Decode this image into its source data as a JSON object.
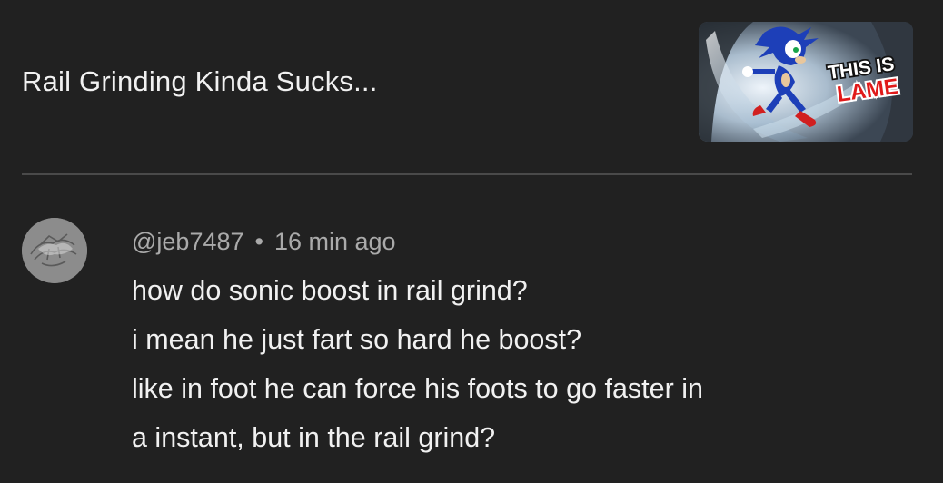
{
  "video": {
    "title": "Rail Grinding Kinda Sucks...",
    "thumbnail": {
      "caption_line1": "THIS IS",
      "caption_line2": "LAME"
    }
  },
  "comment": {
    "author": "@jeb7487",
    "separator": "•",
    "time": "16 min ago",
    "lines": [
      "how do sonic boost in rail grind?",
      "i mean he just fart so hard he boost?",
      "like in foot he can force his foots to go faster in",
      "a instant, but in the rail grind?"
    ]
  },
  "colors": {
    "background": "#212121",
    "text_primary": "#f1f1f1",
    "text_secondary": "#aaaaaa",
    "divider": "#4a4a4a",
    "thumbnail_caption_fill": "#ffffff",
    "thumbnail_caption_red": "#e01a1a"
  }
}
